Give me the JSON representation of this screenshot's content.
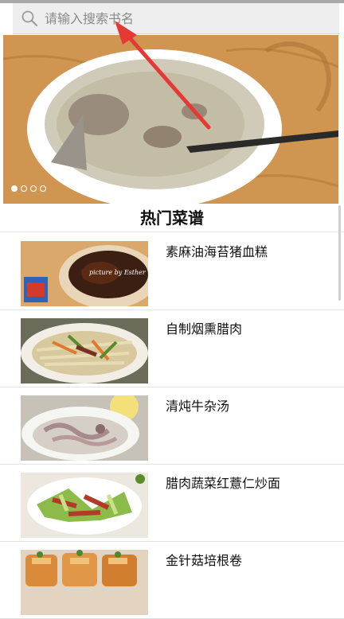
{
  "search": {
    "placeholder": "请输入搜索书名"
  },
  "banner": {
    "dots_total": 4,
    "active_dot": 1
  },
  "section": {
    "title": "热门菜谱"
  },
  "recipes": [
    {
      "title": "素麻油海苔猪血糕",
      "caption": "picture by Esther"
    },
    {
      "title": "自制烟熏腊肉"
    },
    {
      "title": "清炖牛杂汤"
    },
    {
      "title": "腊肉蔬菜红薏仁炒面"
    },
    {
      "title": "金针菇培根卷"
    }
  ],
  "colors": {
    "accent_arrow": "#e53935",
    "search_bg": "#eeeeee"
  }
}
